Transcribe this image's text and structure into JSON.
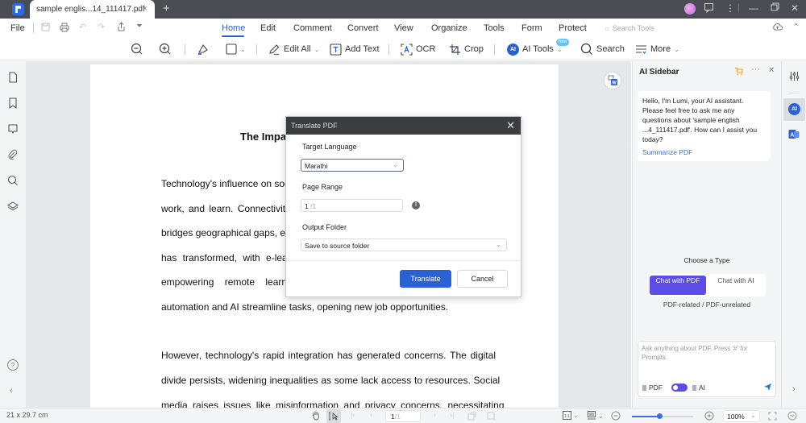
{
  "titlebar": {
    "tab_title": "sample  englis...14_111417.pdf",
    "close_glyph": "×",
    "new_tab_glyph": "+",
    "window_controls": [
      "minimize",
      "restore",
      "close"
    ]
  },
  "menubar": {
    "file": "File",
    "tabs": [
      {
        "label": "Home",
        "active": true
      },
      {
        "label": "Edit"
      },
      {
        "label": "Comment"
      },
      {
        "label": "Convert"
      },
      {
        "label": "View"
      },
      {
        "label": "Organize"
      },
      {
        "label": "Tools"
      },
      {
        "label": "Form"
      },
      {
        "label": "Protect"
      }
    ],
    "search_tools_placeholder": "Search Tools"
  },
  "toolbar": {
    "edit_all": "Edit All",
    "add_text": "Add Text",
    "ocr": "OCR",
    "crop": "Crop",
    "ai_tools": "AI Tools",
    "new_badge": "New",
    "search": "Search",
    "more": "More"
  },
  "document": {
    "title_partial": "The Impa",
    "lines": [
      "Technology's influence on soc",
      "work, and learn. Connectivit",
      "bridges geographical gaps, er",
      "has transformed, with e-lea",
      "empowering remote learnir",
      "automation and AI streamline tasks, opening new job opportunities.",
      "However, technology's rapid integration has generated concerns. The digital",
      "divide persists, widening inequalities as some lack access to resources. Social",
      "media raises issues like misinformation and privacy concerns, necessitating"
    ]
  },
  "dialog": {
    "title": "Translate PDF",
    "target_language_label": "Target Language",
    "target_language_value": "Marathi",
    "page_range_label": "Page Range",
    "page_range_value": "1",
    "page_range_total": "/1",
    "output_folder_label": "Output Folder",
    "output_folder_value": "Save to source folder",
    "translate_button": "Translate",
    "cancel_button": "Cancel"
  },
  "ai_sidebar": {
    "title": "AI Sidebar",
    "greeting": "Hello, I'm Lumi, your AI assistant. Please feel free to ask me any questions about 'sample english ...4_111417.pdf'. How can I assist you today?",
    "summarize_link": "Summarize PDF",
    "choose_type": "Choose a Type",
    "type_pdf": "Chat with PDF",
    "type_ai": "Chat with AI",
    "type_sub": "PDF-related / PDF-unrelated",
    "chat_placeholder": "Ask anything about PDF. Press '#' for Prompts.",
    "toggle_pdf": "PDF",
    "toggle_ai": "AI"
  },
  "statusbar": {
    "page_size": "21 x 29.7 cm",
    "current_page": "1",
    "total_pages": "/1",
    "zoom_level": "100%",
    "zoom_fraction": 0.45
  },
  "colors": {
    "accent": "#2a62d6",
    "ai_purple": "#5b4de6",
    "titlebar": "#4a4d52",
    "dialog_header": "#3b3d41"
  }
}
